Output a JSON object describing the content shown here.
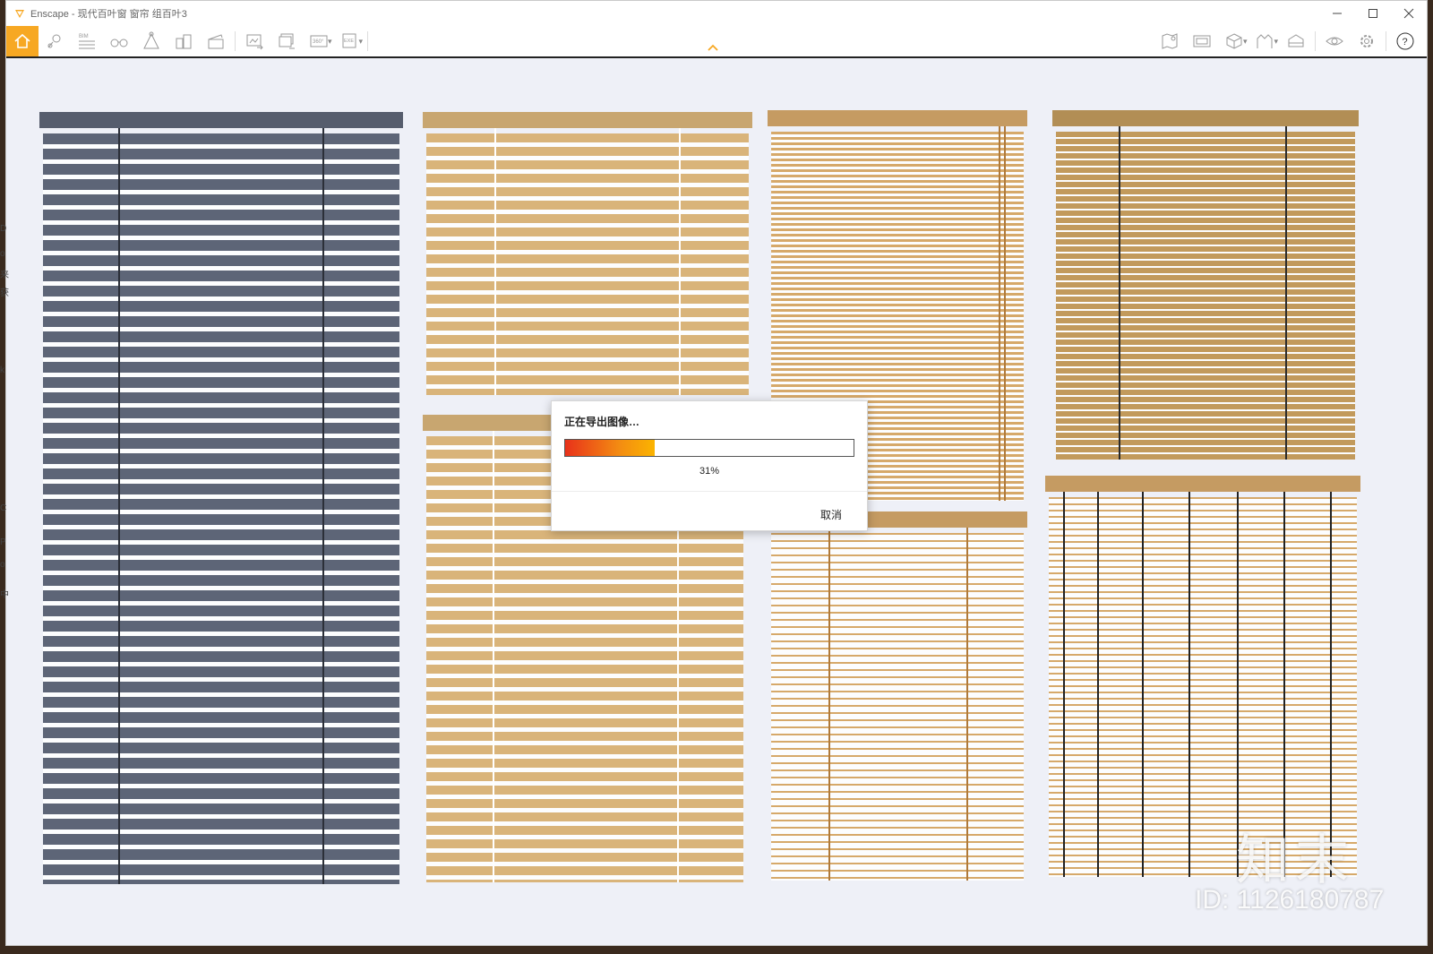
{
  "window": {
    "app_name": "Enscape",
    "title": "Enscape - 现代百叶窗 窗帘 组百叶3"
  },
  "titlebar_controls": [
    "minimize-icon",
    "maximize-icon",
    "close-icon"
  ],
  "toolbar": {
    "left_icons": [
      "home-icon",
      "location-icon",
      "bim-icon",
      "binoculars-icon",
      "asset-library-icon",
      "buildings-icon",
      "clapper-icon",
      "screenshot-icon",
      "batch-render-icon",
      "panorama-360-icon",
      "exe-export-icon"
    ],
    "right_icons": [
      "map-icon",
      "view-management-icon",
      "cube-icon",
      "atmosphere-icon",
      "visual-settings-icon",
      "eye-icon",
      "gear-icon",
      "help-icon"
    ],
    "bim_label": "BIM",
    "pano_label": "360°",
    "exe_label": "EXE"
  },
  "dialog": {
    "title": "正在导出图像…",
    "progress": 0.31,
    "progress_text": "31%",
    "cancel_label": "取消"
  },
  "watermark": {
    "logo_text": "知末",
    "id_text": "ID: 1126180787"
  },
  "side_fragments": [
    "D",
    "o",
    "来",
    "获",
    "k",
    "C",
    "P",
    "o",
    "中"
  ],
  "colors": {
    "accent": "#f7a823",
    "blind_gray": "#5d6577",
    "blind_tan": "#d9b47a",
    "blind_light_tan": "#d6a96a",
    "blind_wood": "#c29a5c"
  }
}
